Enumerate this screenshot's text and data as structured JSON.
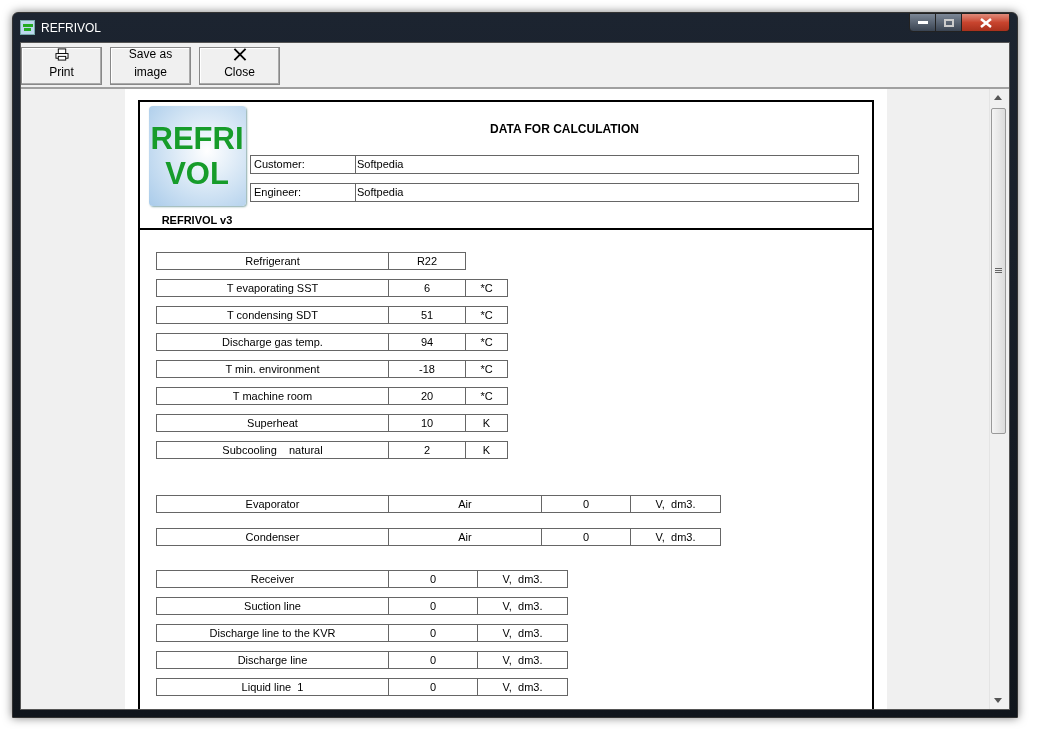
{
  "window": {
    "title": "REFRIVOL"
  },
  "toolbar": [
    {
      "label": "Print",
      "kind": "print"
    },
    {
      "label": "Save as image",
      "kind": "save"
    },
    {
      "label": "Close",
      "kind": "close"
    }
  ],
  "report": {
    "logo": [
      "REFRI",
      "VOL"
    ],
    "version": "REFRIVOL v3",
    "title": "DATA FOR CALCULATION",
    "fields": [
      {
        "label": "Customer:",
        "value": "Softpedia"
      },
      {
        "label": "Engineer:",
        "value": "Softpedia"
      }
    ],
    "parameters": [
      {
        "label": "Refrigerant",
        "value": "R22"
      },
      {
        "label": "T evaporating SST",
        "value": "6",
        "unit": "*C"
      },
      {
        "label": "T condensing SDT",
        "value": "51",
        "unit": "*C"
      },
      {
        "label": "Discharge gas temp.",
        "value": "94",
        "unit": "*C"
      },
      {
        "label": "T min. environment",
        "value": "-18",
        "unit": "*C"
      },
      {
        "label": "T machine room",
        "value": "20",
        "unit": "*C"
      },
      {
        "label": "Superheat",
        "value": "10",
        "unit": "K"
      },
      {
        "label": "Subcooling    natural",
        "value": "2",
        "unit": "K"
      }
    ],
    "exchangers": [
      {
        "label": "Evaporator",
        "medium": "Air",
        "value": "0",
        "unit": "V,  dm3."
      },
      {
        "label": "Condenser",
        "medium": "Air",
        "value": "0",
        "unit": "V,  dm3."
      }
    ],
    "volumes": [
      {
        "label": "Receiver",
        "value": "0",
        "unit": "V,  dm3."
      },
      {
        "label": "Suction line",
        "value": "0",
        "unit": "V,  dm3."
      },
      {
        "label": "Discharge line to the KVR",
        "value": "0",
        "unit": "V,  dm3."
      },
      {
        "label": "Discharge line",
        "value": "0",
        "unit": "V,  dm3."
      },
      {
        "label": "Liquid line  1",
        "value": "0",
        "unit": "V,  dm3."
      }
    ]
  }
}
